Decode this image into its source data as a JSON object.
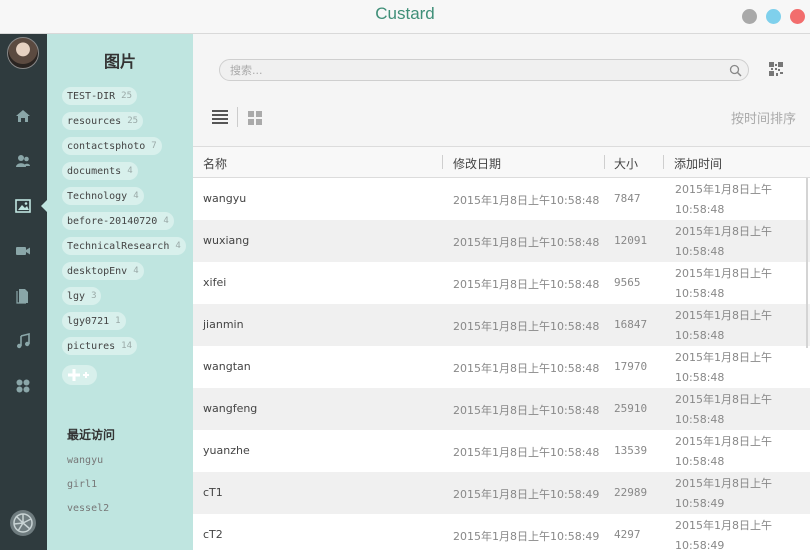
{
  "window": {
    "title": "Custard"
  },
  "sidebar": {
    "title": "图片",
    "tags": [
      {
        "name": "TEST-DIR",
        "count": "25"
      },
      {
        "name": "resources",
        "count": "25"
      },
      {
        "name": "contactsphoto",
        "count": "7"
      },
      {
        "name": "documents",
        "count": "4"
      },
      {
        "name": "Technology",
        "count": "4"
      },
      {
        "name": "before-20140720",
        "count": "4"
      },
      {
        "name": "TechnicalResearch",
        "count": "4"
      },
      {
        "name": "desktopEnv",
        "count": "4"
      },
      {
        "name": "lgy",
        "count": "3"
      },
      {
        "name": "lgy0721",
        "count": "1"
      },
      {
        "name": "pictures",
        "count": "14"
      }
    ],
    "recent_title": "最近访问",
    "recent": [
      "wangyu",
      "girl1",
      "vessel2"
    ]
  },
  "toolbar": {
    "search_placeholder": "搜索...",
    "sort_label": "按时间排序"
  },
  "table": {
    "headers": {
      "name": "名称",
      "modified": "修改日期",
      "size": "大小",
      "added": "添加时间"
    },
    "rows": [
      {
        "name": "wangyu",
        "modified": "2015年1月8日上午10:58:48",
        "size": "7847",
        "added": "2015年1月8日上午10:58:48"
      },
      {
        "name": "wuxiang",
        "modified": "2015年1月8日上午10:58:48",
        "size": "12091",
        "added": "2015年1月8日上午10:58:48"
      },
      {
        "name": "xifei",
        "modified": "2015年1月8日上午10:58:48",
        "size": "9565",
        "added": "2015年1月8日上午10:58:48"
      },
      {
        "name": "jianmin",
        "modified": "2015年1月8日上午10:58:48",
        "size": "16847",
        "added": "2015年1月8日上午10:58:48"
      },
      {
        "name": "wangtan",
        "modified": "2015年1月8日上午10:58:48",
        "size": "17970",
        "added": "2015年1月8日上午10:58:48"
      },
      {
        "name": "wangfeng",
        "modified": "2015年1月8日上午10:58:48",
        "size": "25910",
        "added": "2015年1月8日上午10:58:48"
      },
      {
        "name": "yuanzhe",
        "modified": "2015年1月8日上午10:58:48",
        "size": "13539",
        "added": "2015年1月8日上午10:58:48"
      },
      {
        "name": "cT1",
        "modified": "2015年1月8日上午10:58:49",
        "size": "22989",
        "added": "2015年1月8日上午10:58:49"
      },
      {
        "name": "cT2",
        "modified": "2015年1月8日上午10:58:49",
        "size": "4297",
        "added": "2015年1月8日上午10:58:49"
      }
    ]
  },
  "icons": {
    "rail": [
      "home-icon",
      "contacts-icon",
      "image-icon",
      "video-icon",
      "document-icon",
      "music-icon",
      "apps-icon"
    ]
  },
  "colors": {
    "accent": "#3f8f78",
    "sidebar_bg": "#bfe5e0",
    "rail_bg": "#2f3b3e",
    "close": "#f26d6d",
    "maximize": "#7fd0ec",
    "minimize": "#a9a9a9"
  }
}
